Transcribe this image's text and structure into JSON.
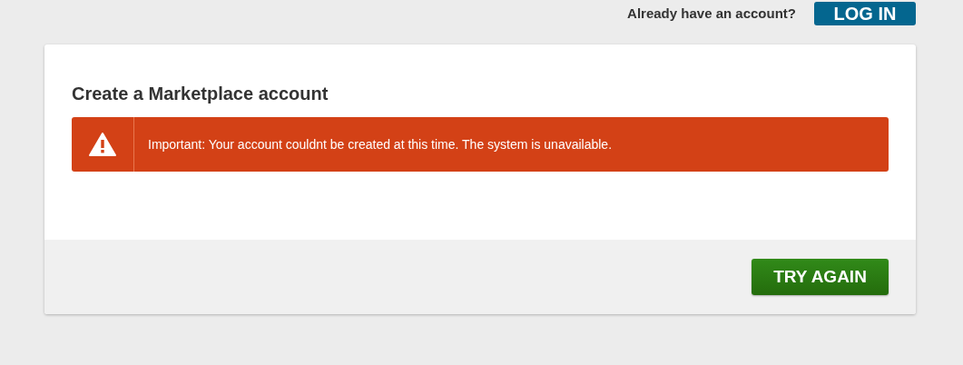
{
  "header": {
    "prompt": "Already have an account?",
    "login_button": "LOG IN"
  },
  "card": {
    "title": "Create a Marketplace account",
    "alert": {
      "kind": "error",
      "message": "Important: Your account couldnt be created at this time. The system is unavailable."
    },
    "button": "TRY AGAIN"
  }
}
